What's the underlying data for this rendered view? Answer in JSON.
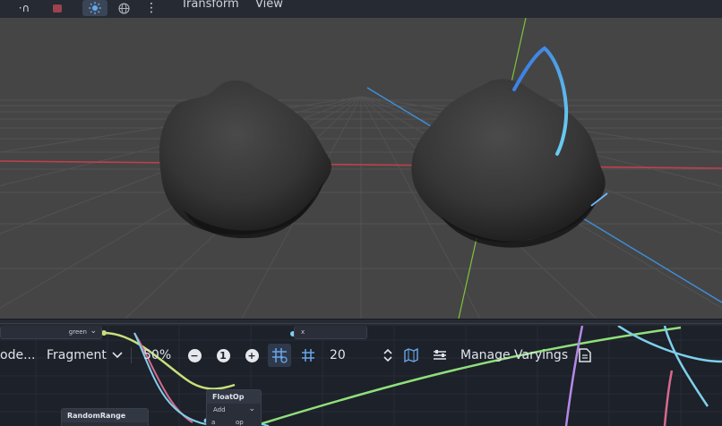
{
  "toolbar": {
    "undo_glyph": "·∩",
    "menu_transform": "Transform",
    "menu_view": "View",
    "more_glyph": "⋮"
  },
  "graph_toolbar": {
    "mode_label": "ode...",
    "shader_type": "Fragment",
    "zoom": "50%",
    "zoom_minus": "−",
    "zoom_reset": "1",
    "zoom_plus": "+",
    "snap_distance": "20",
    "manage_varyings": "Manage Varyings"
  },
  "nodes": {
    "green_port": "green",
    "x_port": "x",
    "floatop_title": "FloatOp",
    "floatop_op": "Add",
    "port_a": "a",
    "port_op": "op",
    "randomrange_title": "RandomRange"
  },
  "colors": {
    "viewport_bg": "#454545",
    "x_axis": "#c0404a",
    "y_axis": "#7fc33a",
    "z_axis": "#3f8fdd",
    "accent": "#5aa0e6",
    "graph_bg": "#1d2129",
    "wire_green": "#8fe07a",
    "wire_cyan": "#7fd0ec",
    "wire_purple": "#b48ae6",
    "wire_pink": "#d66a8e"
  }
}
